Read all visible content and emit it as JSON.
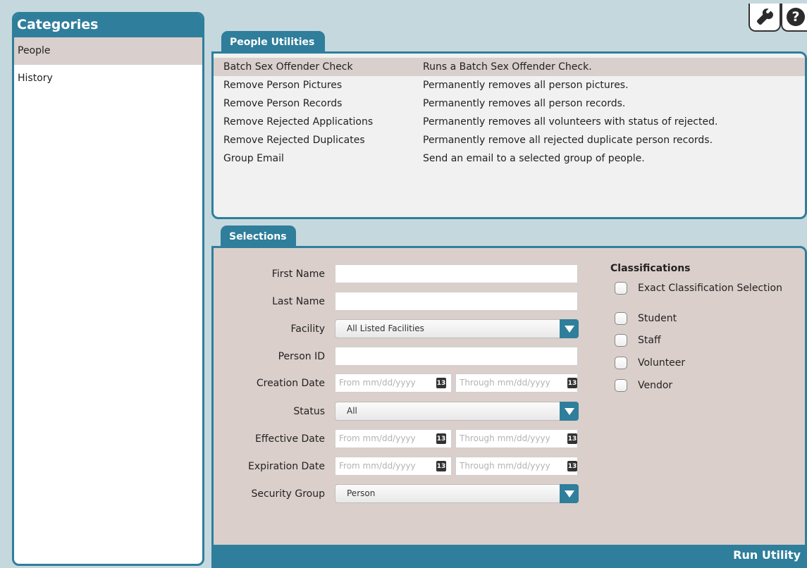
{
  "sidebar": {
    "title": "Categories",
    "items": [
      {
        "label": "People",
        "selected": true
      },
      {
        "label": "History",
        "selected": false
      }
    ]
  },
  "toolbar": {
    "settings_icon": "wrench-icon",
    "help_icon": "question-icon",
    "help_glyph": "?"
  },
  "utilities": {
    "tab_label": "People Utilities",
    "rows": [
      {
        "name": "Batch Sex Offender Check",
        "desc": "Runs a Batch Sex Offender Check."
      },
      {
        "name": "Remove Person Pictures",
        "desc": "Permanently removes all person pictures."
      },
      {
        "name": "Remove Person Records",
        "desc": "Permanently removes all person records."
      },
      {
        "name": "Remove Rejected Applications",
        "desc": "Permanently removes all volunteers with status of rejected."
      },
      {
        "name": "Remove Rejected Duplicates",
        "desc": "Permanently remove all rejected duplicate person records."
      },
      {
        "name": "Group Email",
        "desc": "Send an email to a selected group of people."
      }
    ]
  },
  "selections": {
    "tab_label": "Selections",
    "first_name": {
      "label": "First Name",
      "value": ""
    },
    "last_name": {
      "label": "Last Name",
      "value": ""
    },
    "facility": {
      "label": "Facility",
      "value": "All Listed Facilities"
    },
    "person_id": {
      "label": "Person ID",
      "value": ""
    },
    "creation_date": {
      "label": "Creation Date",
      "from_placeholder": "From mm/dd/yyyy",
      "through_placeholder": "Through mm/dd/yyyy"
    },
    "status": {
      "label": "Status",
      "value": "All"
    },
    "effective_date": {
      "label": "Effective Date",
      "from_placeholder": "From mm/dd/yyyy",
      "through_placeholder": "Through mm/dd/yyyy"
    },
    "expiration_date": {
      "label": "Expiration Date",
      "from_placeholder": "From mm/dd/yyyy",
      "through_placeholder": "Through mm/dd/yyyy"
    },
    "security_group": {
      "label": "Security Group",
      "value": "Person"
    },
    "calendar_glyph": "13",
    "classifications": {
      "title": "Classifications",
      "exact": "Exact Classification Selection",
      "options": [
        "Student",
        "Staff",
        "Volunteer",
        "Vendor"
      ]
    },
    "run_label": "Run Utility"
  },
  "colors": {
    "accent": "#2f7e9b",
    "selected_row": "#d9cfcc",
    "background": "#c5d8de"
  }
}
